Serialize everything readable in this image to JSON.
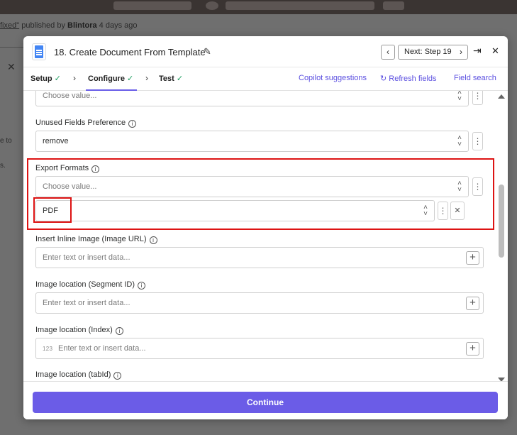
{
  "background": {
    "subtitle": {
      "link": "fixed\"",
      "published_by": "published by",
      "author": "Blintora",
      "age": "4 days ago"
    },
    "fragments": [
      "e to",
      "s."
    ]
  },
  "modal": {
    "title": "18. Create Document From Template",
    "next_label": "Next: Step 19",
    "tabs": [
      {
        "label": "Setup"
      },
      {
        "label": "Configure"
      },
      {
        "label": "Test"
      }
    ],
    "actions": {
      "copilot": "Copilot suggestions",
      "refresh": "Refresh fields",
      "field_search": "Field search"
    },
    "fields": {
      "top_value_placeholder": "Choose value...",
      "unused_pref": {
        "label": "Unused Fields Preference",
        "value": "remove"
      },
      "export_formats": {
        "label": "Export Formats",
        "placeholder": "Choose value...",
        "value": "PDF"
      },
      "inline_image": {
        "label": "Insert Inline Image (Image URL)",
        "placeholder": "Enter text or insert data..."
      },
      "segment_id": {
        "label": "Image location (Segment ID)",
        "placeholder": "Enter text or insert data..."
      },
      "index": {
        "label": "Image location (Index)",
        "placeholder": "Enter text or insert data...",
        "type_badge": "123"
      },
      "tab_id": {
        "label": "Image location (tabId)"
      }
    },
    "continue_label": "Continue"
  },
  "colors": {
    "accent": "#6b5ce7",
    "highlight": "#dd1313",
    "check": "#1a9c5e",
    "doc_icon": "#4285f4"
  }
}
